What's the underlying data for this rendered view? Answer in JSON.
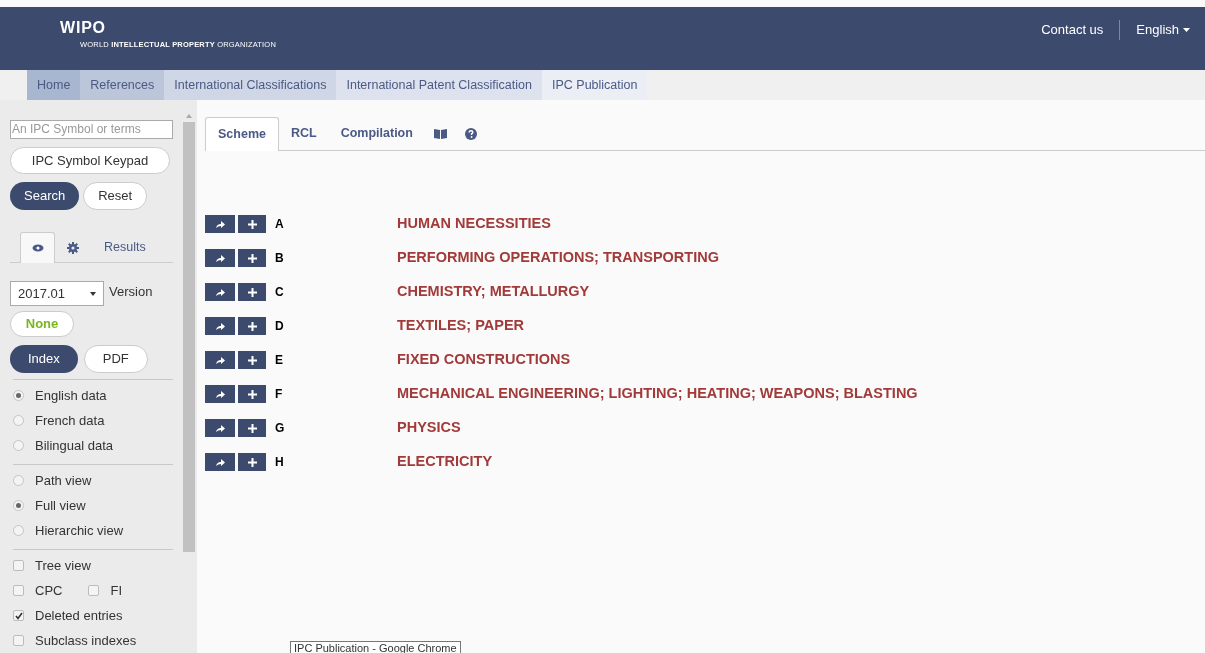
{
  "header": {
    "logo_title": "WIPO",
    "logo_subtitle": "WORLD **INTELLECTUAL PROPERTY** ORGANIZATION",
    "contact": "Contact us",
    "language": "English"
  },
  "breadcrumb": [
    "Home",
    "References",
    "International Classifications",
    "International Patent Classification",
    "IPC Publication"
  ],
  "sidebar": {
    "search": {
      "placeholder": "An IPC Symbol or terms"
    },
    "keypad_button": "IPC Symbol Keypad",
    "search_button": "Search",
    "reset_button": "Reset",
    "tabs": [
      {
        "kind": "eye",
        "selected": true
      },
      {
        "kind": "gear",
        "selected": false
      },
      {
        "kind": "text",
        "label": "Results",
        "selected": false
      }
    ],
    "version": {
      "value": "2017.01",
      "label": "Version"
    },
    "none_button": "None",
    "formats": [
      {
        "label": "Index",
        "selected": true
      },
      {
        "label": "PDF",
        "selected": false
      }
    ],
    "option_groups": [
      {
        "kind": "radio",
        "rows": [
          [
            {
              "label": "English data",
              "checked": true
            }
          ],
          [
            {
              "label": "French data",
              "checked": false
            }
          ],
          [
            {
              "label": "Bilingual data",
              "checked": false
            }
          ]
        ]
      },
      {
        "kind": "radio",
        "rows": [
          [
            {
              "label": "Path view",
              "checked": false
            }
          ],
          [
            {
              "label": "Full view",
              "checked": true
            }
          ],
          [
            {
              "label": "Hierarchic view",
              "checked": false
            }
          ]
        ]
      },
      {
        "kind": "checkbox",
        "rows": [
          [
            {
              "label": "Tree view",
              "checked": false
            }
          ],
          [
            {
              "label": "CPC",
              "checked": false
            },
            {
              "label": "FI",
              "checked": false
            }
          ],
          [
            {
              "label": "Deleted entries",
              "checked": true
            }
          ],
          [
            {
              "label": "Subclass indexes",
              "checked": false
            }
          ]
        ]
      }
    ]
  },
  "main_tabs": [
    {
      "kind": "text",
      "label": "Scheme",
      "selected": true
    },
    {
      "kind": "text",
      "label": "RCL",
      "selected": false
    },
    {
      "kind": "text",
      "label": "Compilation",
      "selected": false
    },
    {
      "kind": "book",
      "selected": false
    },
    {
      "kind": "help",
      "selected": false
    }
  ],
  "sections": [
    {
      "symbol": "A",
      "title": "HUMAN NECESSITIES"
    },
    {
      "symbol": "B",
      "title": "PERFORMING OPERATIONS; TRANSPORTING"
    },
    {
      "symbol": "C",
      "title": "CHEMISTRY; METALLURGY"
    },
    {
      "symbol": "D",
      "title": "TEXTILES; PAPER"
    },
    {
      "symbol": "E",
      "title": "FIXED CONSTRUCTIONS"
    },
    {
      "symbol": "F",
      "title": "MECHANICAL ENGINEERING; LIGHTING; HEATING; WEAPONS; BLASTING"
    },
    {
      "symbol": "G",
      "title": "PHYSICS"
    },
    {
      "symbol": "H",
      "title": "ELECTRICITY"
    }
  ],
  "tooltip": "IPC Publication - Google Chrome"
}
